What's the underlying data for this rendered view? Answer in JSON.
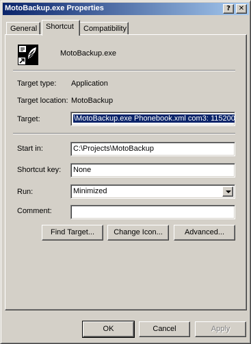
{
  "window": {
    "title": "MotoBackup.exe Properties",
    "help_glyph": "?",
    "close_glyph": "✕"
  },
  "tabs": [
    {
      "label": "General"
    },
    {
      "label": "Shortcut"
    },
    {
      "label": "Compatibility"
    }
  ],
  "shortcut": {
    "name": "MotoBackup.exe",
    "target_type_label": "Target type:",
    "target_type_value": "Application",
    "target_location_label": "Target location:",
    "target_location_value": "MotoBackup",
    "target_label": "Target:",
    "target_value": "\\MotoBackup.exe Phonebook.xml com3: 115200",
    "start_in_label": "Start in:",
    "start_in_value": "C:\\Projects\\MotoBackup",
    "shortcut_key_label": "Shortcut key:",
    "shortcut_key_value": "None",
    "run_label": "Run:",
    "run_value": "Minimized",
    "comment_label": "Comment:",
    "comment_value": ""
  },
  "buttons": {
    "find_target": "Find Target...",
    "change_icon": "Change Icon...",
    "advanced": "Advanced...",
    "ok": "OK",
    "cancel": "Cancel",
    "apply": "Apply"
  },
  "colors": {
    "title_start": "#0a246a",
    "title_end": "#a6caf0",
    "face": "#d4d0c8",
    "selection": "#0a246a"
  }
}
